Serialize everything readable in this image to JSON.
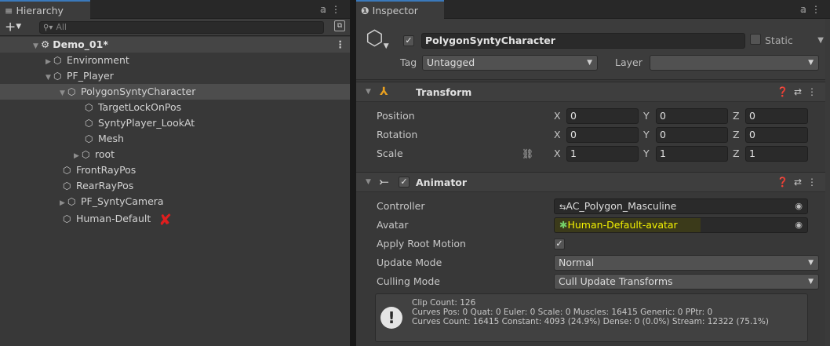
{
  "hierarchy": {
    "tab_label": "Hierarchy",
    "tab_icon": "≡",
    "search_placeholder": "All",
    "scene_name": "Demo_01*",
    "items": [
      {
        "label": "Environment"
      },
      {
        "label": "PF_Player"
      },
      {
        "label": "PolygonSyntyCharacter"
      },
      {
        "label": "TargetLockOnPos"
      },
      {
        "label": "SyntyPlayer_LookAt"
      },
      {
        "label": "Mesh"
      },
      {
        "label": "root"
      },
      {
        "label": "FrontRayPos"
      },
      {
        "label": "RearRayPos"
      },
      {
        "label": "PF_SyntyCamera"
      },
      {
        "label": "Human-Default"
      }
    ]
  },
  "inspector": {
    "tab_label": "Inspector",
    "object_name": "PolygonSyntyCharacter",
    "static_label": "Static",
    "tag_label": "Tag",
    "tag_value": "Untagged",
    "layer_label": "Layer",
    "layer_value": "",
    "transform": {
      "title": "Transform",
      "position_label": "Position",
      "rotation_label": "Rotation",
      "scale_label": "Scale",
      "x": "X",
      "y": "Y",
      "z": "Z",
      "position": [
        "0",
        "0",
        "0"
      ],
      "rotation": [
        "0",
        "0",
        "0"
      ],
      "scale": [
        "1",
        "1",
        "1"
      ]
    },
    "animator": {
      "title": "Animator",
      "controller_label": "Controller",
      "controller_value": "AC_Polygon_Masculine",
      "avatar_label": "Avatar",
      "avatar_value": "Human-Default-avatar",
      "apply_root_motion_label": "Apply Root Motion",
      "update_mode_label": "Update Mode",
      "update_mode_value": "Normal",
      "culling_mode_label": "Culling Mode",
      "culling_mode_value": "Cull Update Transforms",
      "info_lines": [
        "Clip Count: 126",
        "Curves Pos: 0 Quat: 0 Euler: 0 Scale: 0 Muscles: 16415 Generic: 0 PPtr: 0",
        "Curves Count: 16415 Constant: 4093 (24.9%) Dense: 0 (0.0%) Stream: 12322 (75.1%)"
      ]
    }
  },
  "colors": {
    "accent": "#3a79bb",
    "warning_x": "#e01e1e",
    "avatar_highlight": "#f4f200",
    "panel_bg": "#383838"
  }
}
